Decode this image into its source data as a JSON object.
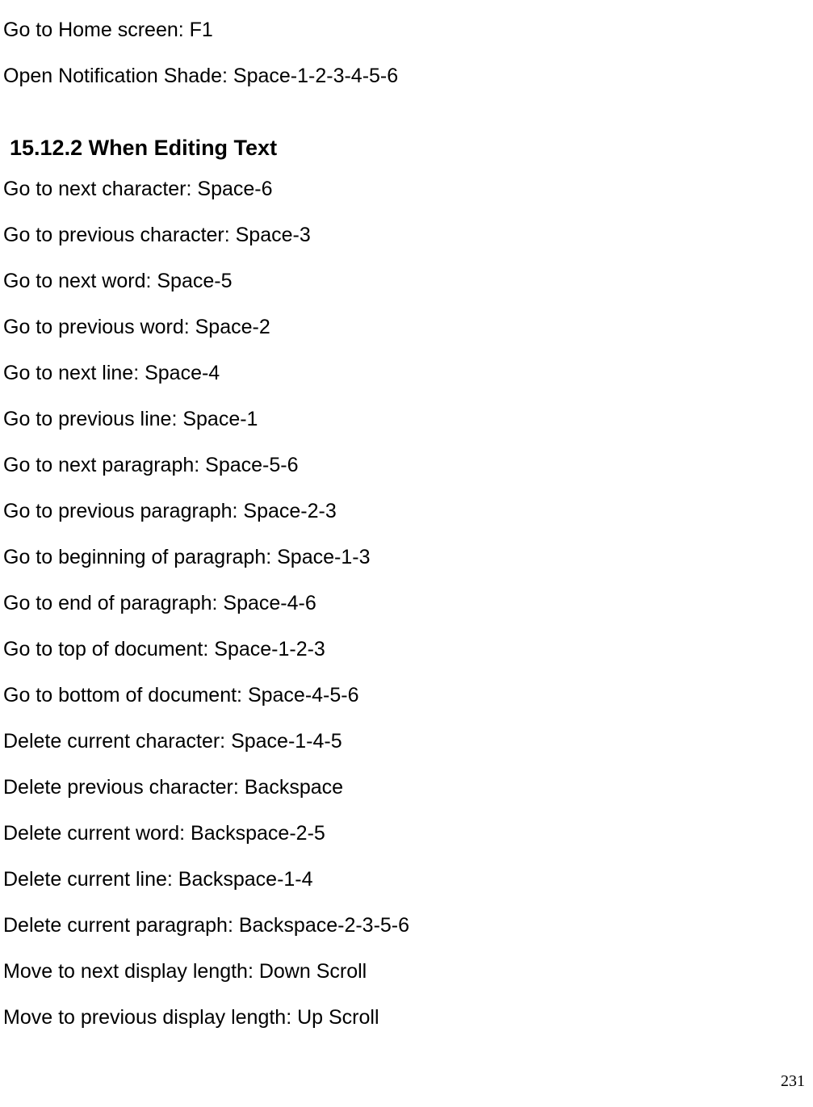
{
  "intro_lines": [
    "Go to Home screen: F1",
    "Open Notification Shade: Space-1-2-3-4-5-6"
  ],
  "section_heading": "15.12.2 When Editing Text",
  "editing_lines": [
    "Go to next character: Space-6",
    "Go to previous character: Space-3",
    "Go to next word: Space-5",
    "Go to previous word: Space-2",
    "Go to next line: Space-4",
    "Go to previous line: Space-1",
    "Go to next paragraph: Space-5-6",
    "Go to previous paragraph: Space-2-3",
    "Go to beginning of paragraph: Space-1-3",
    "Go to end of paragraph: Space-4-6",
    "Go to top of document: Space-1-2-3",
    "Go to bottom of document: Space-4-5-6",
    "Delete current character: Space-1-4-5",
    "Delete previous character: Backspace",
    "Delete current word: Backspace-2-5",
    "Delete current line: Backspace-1-4",
    "Delete current paragraph: Backspace-2-3-5-6",
    "Move to next display length: Down Scroll",
    "Move to previous display length: Up Scroll"
  ],
  "page_number": "231"
}
